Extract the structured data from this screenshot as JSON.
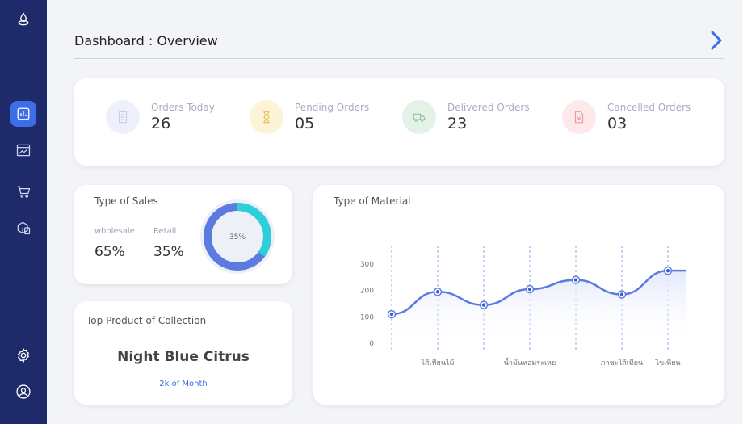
{
  "header": {
    "title": "Dashboard : Overview"
  },
  "stats": [
    {
      "label": "Orders Today",
      "value": "26"
    },
    {
      "label": "Pending Orders",
      "value": "05"
    },
    {
      "label": "Delivered Orders",
      "value": "23"
    },
    {
      "label": "Cancelled Orders",
      "value": "03"
    }
  ],
  "sales": {
    "title": "Type of Sales",
    "wholesale_label": "wholesale",
    "wholesale_value": "65%",
    "retail_label": "Retail",
    "retail_value": "35%",
    "donut_label": "35%"
  },
  "top_product": {
    "title": "Top Product of Collection",
    "name": "Night Blue Citrus",
    "sub": "2k of Month"
  },
  "material": {
    "title": "Type of Material"
  },
  "colors": {
    "sidebar": "#1f2a6b",
    "accent": "#3e6de8",
    "line": "#5b7be0",
    "donut_primary": "#5b7be0",
    "donut_secondary": "#2ecfd8"
  },
  "chart_data": {
    "type": "area",
    "title": "Type of Material",
    "x": [
      "",
      "ไส้เทียนไม้",
      "",
      "น้ำมันหอมระเหย",
      "",
      "ภาชะไส้เทียน",
      "ไขเทียน"
    ],
    "y": [
      110,
      195,
      145,
      205,
      240,
      185,
      275
    ],
    "yticks": [
      "0",
      "100",
      "200",
      "300"
    ],
    "ylim": [
      0,
      300
    ]
  }
}
